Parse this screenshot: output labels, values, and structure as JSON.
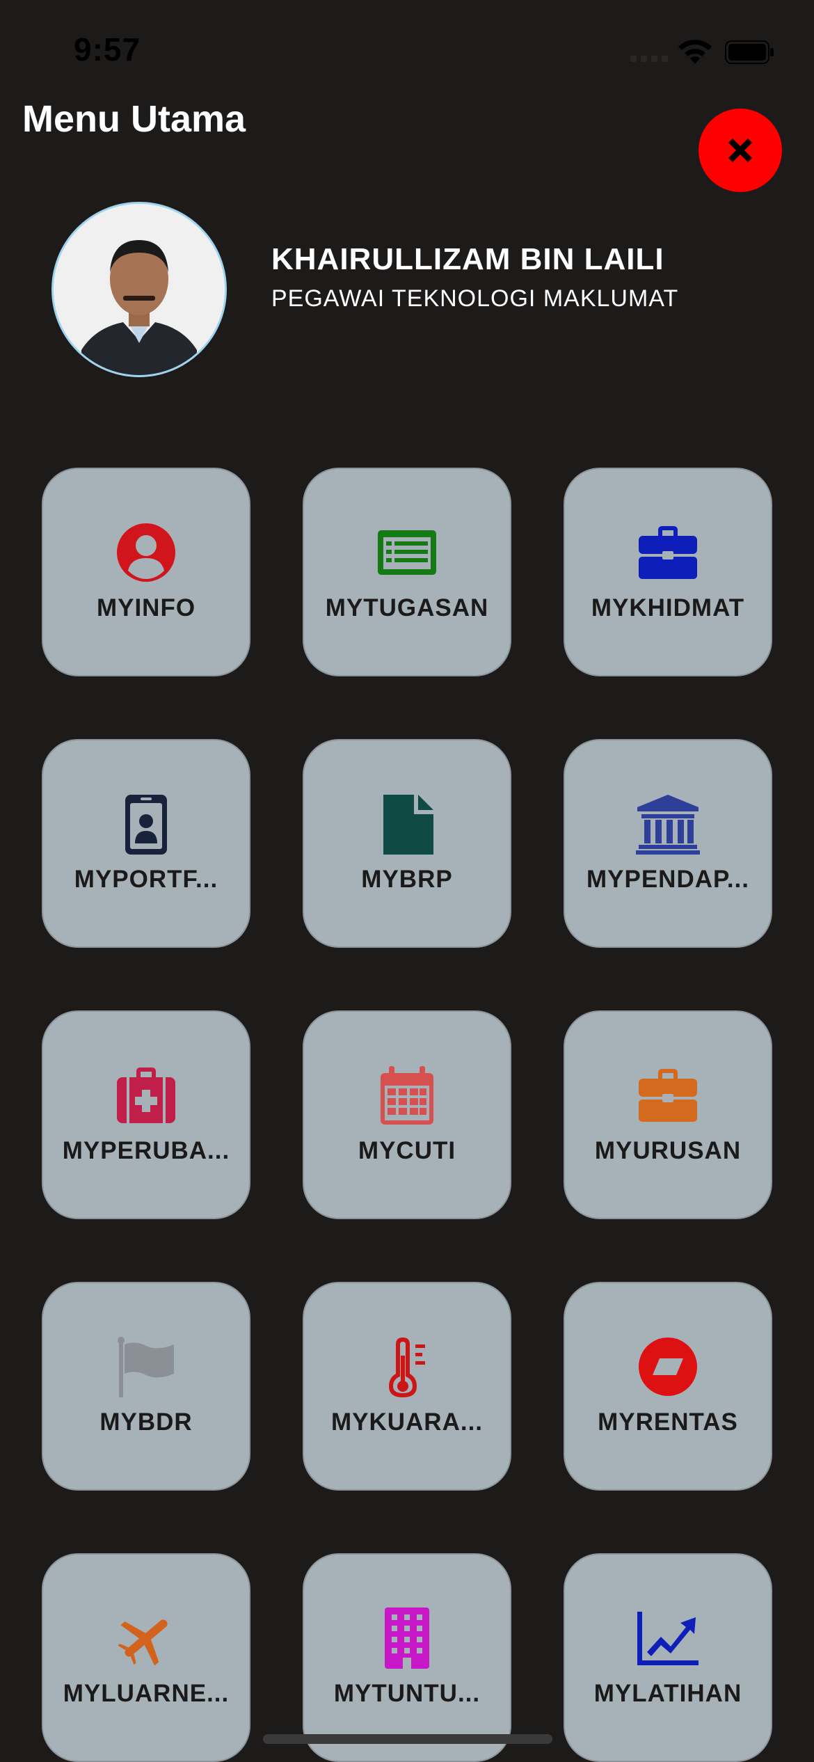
{
  "status_bar": {
    "time": "9:57"
  },
  "header": {
    "title": "Menu Utama",
    "close_icon": "x-mark-icon"
  },
  "profile": {
    "name": "KHAIRULLIZAM BIN LAILI",
    "position": "PEGAWAI TEKNOLOGI MAKLUMAT"
  },
  "menu": [
    {
      "label": "MYINFO",
      "icon": "user-circle-icon",
      "color": "#d0161c"
    },
    {
      "label": "MYTUGASAN",
      "icon": "list-card-icon",
      "color": "#147a14"
    },
    {
      "label": "MYKHIDMAT",
      "icon": "briefcase-icon",
      "color": "#0d1fb8"
    },
    {
      "label": "MYPORTF...",
      "icon": "id-badge-icon",
      "color": "#16233a"
    },
    {
      "label": "MYBRP",
      "icon": "file-icon",
      "color": "#0f4a44"
    },
    {
      "label": "MYPENDAP...",
      "icon": "bank-icon",
      "color": "#2e3f9a"
    },
    {
      "label": "MYPERUBA...",
      "icon": "medkit-icon",
      "color": "#bf1f48"
    },
    {
      "label": "MYCUTI",
      "icon": "calendar-icon",
      "color": "#d65050"
    },
    {
      "label": "MYURUSAN",
      "icon": "briefcase-icon",
      "color": "#d36a1e"
    },
    {
      "label": "MYBDR",
      "icon": "flag-icon",
      "color": "#8a9096"
    },
    {
      "label": "MYKUARA...",
      "icon": "thermometer-icon",
      "color": "#cc1515"
    },
    {
      "label": "MYRENTAS",
      "icon": "parallelogram-circle-icon",
      "color": "#dd1111"
    },
    {
      "label": "MYLUARNE...",
      "icon": "plane-icon",
      "color": "#d3631c"
    },
    {
      "label": "MYTUNTU...",
      "icon": "building-icon",
      "color": "#c717c7"
    },
    {
      "label": "MYLATIHAN",
      "icon": "chart-line-icon",
      "color": "#0d1fb8"
    }
  ]
}
